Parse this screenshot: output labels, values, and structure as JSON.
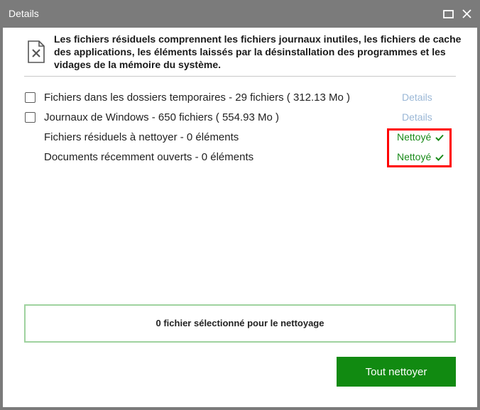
{
  "window": {
    "title": "Details"
  },
  "description": "Les fichiers résiduels comprennent les fichiers journaux inutiles, les fichiers de cache des applications, les éléments laissés par la désinstallation des programmes et les vidages de la mémoire du système.",
  "items": [
    {
      "label": "Fichiers dans les dossiers temporaires - 29 fichiers ( 312.13 Mo )",
      "details_label": "Details",
      "checked": false
    },
    {
      "label": "Journaux de Windows - 650 fichiers ( 554.93 Mo )",
      "details_label": "Details",
      "checked": false
    },
    {
      "label": "Fichiers résiduels à nettoyer - 0 éléments",
      "status": "Nettoyé"
    },
    {
      "label": "Documents récemment ouverts - 0 éléments",
      "status": "Nettoyé"
    }
  ],
  "summary": "0 fichier sélectionné pour le nettoyage",
  "clean_button": "Tout nettoyer",
  "colors": {
    "accent_green": "#118a11",
    "status_green": "#1a8a1a",
    "highlight_red": "#ff0000",
    "details_link": "#9ab7d6",
    "summary_border": "#9fd29f"
  },
  "icons": {
    "maximize": "maximize-icon",
    "close": "close-icon",
    "document": "document-x-icon",
    "check": "check-icon"
  }
}
